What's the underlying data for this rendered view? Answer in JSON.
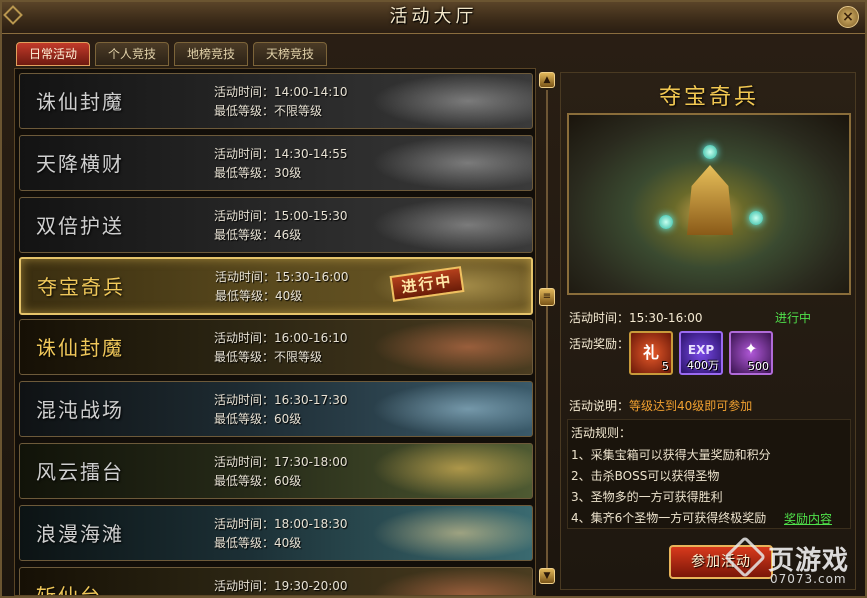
{
  "window": {
    "title": "活动大厅",
    "close_label": "×"
  },
  "tabs": [
    {
      "label": "日常活动",
      "active": true
    },
    {
      "label": "个人竞技",
      "active": false
    },
    {
      "label": "地榜竞技",
      "active": false
    },
    {
      "label": "天榜竞技",
      "active": false
    }
  ],
  "activities": [
    {
      "name": "诛仙封魔",
      "time_label": "活动时间：",
      "time": "14:00-14:10",
      "level_label": "最低等级：",
      "level": "不限等级",
      "style": "gray"
    },
    {
      "name": "天降横财",
      "time_label": "活动时间：",
      "time": "14:30-14:55",
      "level_label": "最低等级：",
      "level": "30级",
      "style": "gray"
    },
    {
      "name": "双倍护送",
      "time_label": "活动时间：",
      "time": "15:00-15:30",
      "level_label": "最低等级：",
      "level": "46级",
      "style": "gray"
    },
    {
      "name": "夺宝奇兵",
      "time_label": "活动时间：",
      "time": "15:30-16:00",
      "level_label": "最低等级：",
      "level": "40级",
      "style": "selected",
      "stamp": "进行中"
    },
    {
      "name": "诛仙封魔",
      "time_label": "活动时间：",
      "time": "16:00-16:10",
      "level_label": "最低等级：",
      "level": "不限等级",
      "style": "colored"
    },
    {
      "name": "混沌战场",
      "time_label": "活动时间：",
      "time": "16:30-17:30",
      "level_label": "最低等级：",
      "level": "60级",
      "style": "c-blue"
    },
    {
      "name": "风云擂台",
      "time_label": "活动时间：",
      "time": "17:30-18:00",
      "level_label": "最低等级：",
      "level": "60级",
      "style": "c-green"
    },
    {
      "name": "浪漫海滩",
      "time_label": "活动时间：",
      "time": "18:00-18:30",
      "level_label": "最低等级：",
      "level": "40级",
      "style": "c-teal"
    },
    {
      "name": "斩仙台",
      "time_label": "活动时间：",
      "time": "19:30-20:00",
      "level_label": "",
      "level": "",
      "style": "colored"
    }
  ],
  "scroll": {
    "up": "▲",
    "down": "▼",
    "thumb": "≡"
  },
  "detail": {
    "title": "夺宝奇兵",
    "time_label": "活动时间：",
    "time": "15:30-16:00",
    "status": "进行中",
    "rewards_label": "活动奖励：",
    "rewards": [
      {
        "icon": "gift-box-icon",
        "symbol": "礼",
        "qty": "5"
      },
      {
        "icon": "exp-orb-icon",
        "symbol": "EXP",
        "qty": "400万"
      },
      {
        "icon": "wing-sword-icon",
        "symbol": "✦",
        "qty": "500"
      }
    ],
    "desc_label": "活动说明：",
    "desc": "等级达到40级即可参加",
    "rules_label": "活动规则：",
    "rules": [
      "1、采集宝箱可以获得大量奖励和积分",
      "2、击杀BOSS可以获得圣物",
      "3、圣物多的一方可获得胜利",
      "4、集齐6个圣物一方可获得终极奖励"
    ],
    "reward_link": "奖励内容",
    "join_button": "参加活动"
  },
  "watermark": {
    "text": "页游戏",
    "url": "07073.com"
  },
  "colors": {
    "accent_gold": "#f2c852",
    "status_green": "#4fe04a",
    "desc_orange": "#f0a030",
    "tab_active_red": "#c23a2a"
  }
}
